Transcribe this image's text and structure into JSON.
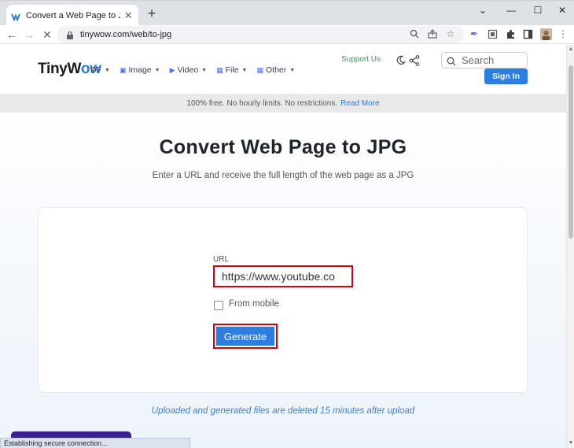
{
  "browser": {
    "tab_title": "Convert a Web Page to JPG from",
    "url": "tinywow.com/web/to-jpg"
  },
  "header": {
    "logo_part1": "TinyW",
    "logo_part2": "ow",
    "nav": [
      {
        "label": "DF",
        "icon": "pdf-icon"
      },
      {
        "label": "Image",
        "icon": "image-icon"
      },
      {
        "label": "Video",
        "icon": "video-icon"
      },
      {
        "label": "File",
        "icon": "grid-icon"
      },
      {
        "label": "Other",
        "icon": "grid-icon"
      }
    ],
    "support_label": "Support Us",
    "search_placeholder": "Search",
    "signin_label": "Sign In"
  },
  "banner": {
    "text": "100% free. No hourly limits. No restrictions.",
    "link": "Read More"
  },
  "main": {
    "title": "Convert Web Page to JPG",
    "subtitle": "Enter a URL and receive the full length of the web page as a JPG",
    "url_label": "URL",
    "url_value": "https://www.youtube.co",
    "checkbox_label": "From mobile",
    "generate_label": "Generate",
    "note": "Uploaded and generated files are deleted 15 minutes after upload"
  },
  "status_text": "Establishing secure connection...",
  "colors": {
    "accent": "#2c7ee0",
    "highlight": "#d0021b",
    "support": "#3c9a5f"
  }
}
